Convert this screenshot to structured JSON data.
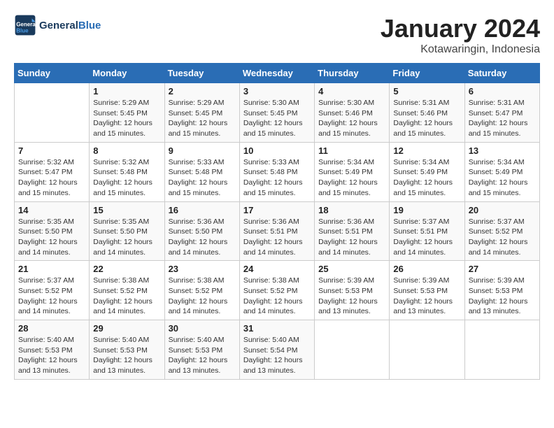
{
  "header": {
    "logo_text_general": "General",
    "logo_text_blue": "Blue",
    "title": "January 2024",
    "subtitle": "Kotawaringin, Indonesia"
  },
  "columns": [
    "Sunday",
    "Monday",
    "Tuesday",
    "Wednesday",
    "Thursday",
    "Friday",
    "Saturday"
  ],
  "weeks": [
    [
      {
        "day": "",
        "info": ""
      },
      {
        "day": "1",
        "info": "Sunrise: 5:29 AM\nSunset: 5:45 PM\nDaylight: 12 hours\nand 15 minutes."
      },
      {
        "day": "2",
        "info": "Sunrise: 5:29 AM\nSunset: 5:45 PM\nDaylight: 12 hours\nand 15 minutes."
      },
      {
        "day": "3",
        "info": "Sunrise: 5:30 AM\nSunset: 5:45 PM\nDaylight: 12 hours\nand 15 minutes."
      },
      {
        "day": "4",
        "info": "Sunrise: 5:30 AM\nSunset: 5:46 PM\nDaylight: 12 hours\nand 15 minutes."
      },
      {
        "day": "5",
        "info": "Sunrise: 5:31 AM\nSunset: 5:46 PM\nDaylight: 12 hours\nand 15 minutes."
      },
      {
        "day": "6",
        "info": "Sunrise: 5:31 AM\nSunset: 5:47 PM\nDaylight: 12 hours\nand 15 minutes."
      }
    ],
    [
      {
        "day": "7",
        "info": "Sunrise: 5:32 AM\nSunset: 5:47 PM\nDaylight: 12 hours\nand 15 minutes."
      },
      {
        "day": "8",
        "info": "Sunrise: 5:32 AM\nSunset: 5:48 PM\nDaylight: 12 hours\nand 15 minutes."
      },
      {
        "day": "9",
        "info": "Sunrise: 5:33 AM\nSunset: 5:48 PM\nDaylight: 12 hours\nand 15 minutes."
      },
      {
        "day": "10",
        "info": "Sunrise: 5:33 AM\nSunset: 5:48 PM\nDaylight: 12 hours\nand 15 minutes."
      },
      {
        "day": "11",
        "info": "Sunrise: 5:34 AM\nSunset: 5:49 PM\nDaylight: 12 hours\nand 15 minutes."
      },
      {
        "day": "12",
        "info": "Sunrise: 5:34 AM\nSunset: 5:49 PM\nDaylight: 12 hours\nand 15 minutes."
      },
      {
        "day": "13",
        "info": "Sunrise: 5:34 AM\nSunset: 5:49 PM\nDaylight: 12 hours\nand 15 minutes."
      }
    ],
    [
      {
        "day": "14",
        "info": "Sunrise: 5:35 AM\nSunset: 5:50 PM\nDaylight: 12 hours\nand 14 minutes."
      },
      {
        "day": "15",
        "info": "Sunrise: 5:35 AM\nSunset: 5:50 PM\nDaylight: 12 hours\nand 14 minutes."
      },
      {
        "day": "16",
        "info": "Sunrise: 5:36 AM\nSunset: 5:50 PM\nDaylight: 12 hours\nand 14 minutes."
      },
      {
        "day": "17",
        "info": "Sunrise: 5:36 AM\nSunset: 5:51 PM\nDaylight: 12 hours\nand 14 minutes."
      },
      {
        "day": "18",
        "info": "Sunrise: 5:36 AM\nSunset: 5:51 PM\nDaylight: 12 hours\nand 14 minutes."
      },
      {
        "day": "19",
        "info": "Sunrise: 5:37 AM\nSunset: 5:51 PM\nDaylight: 12 hours\nand 14 minutes."
      },
      {
        "day": "20",
        "info": "Sunrise: 5:37 AM\nSunset: 5:52 PM\nDaylight: 12 hours\nand 14 minutes."
      }
    ],
    [
      {
        "day": "21",
        "info": "Sunrise: 5:37 AM\nSunset: 5:52 PM\nDaylight: 12 hours\nand 14 minutes."
      },
      {
        "day": "22",
        "info": "Sunrise: 5:38 AM\nSunset: 5:52 PM\nDaylight: 12 hours\nand 14 minutes."
      },
      {
        "day": "23",
        "info": "Sunrise: 5:38 AM\nSunset: 5:52 PM\nDaylight: 12 hours\nand 14 minutes."
      },
      {
        "day": "24",
        "info": "Sunrise: 5:38 AM\nSunset: 5:52 PM\nDaylight: 12 hours\nand 14 minutes."
      },
      {
        "day": "25",
        "info": "Sunrise: 5:39 AM\nSunset: 5:53 PM\nDaylight: 12 hours\nand 13 minutes."
      },
      {
        "day": "26",
        "info": "Sunrise: 5:39 AM\nSunset: 5:53 PM\nDaylight: 12 hours\nand 13 minutes."
      },
      {
        "day": "27",
        "info": "Sunrise: 5:39 AM\nSunset: 5:53 PM\nDaylight: 12 hours\nand 13 minutes."
      }
    ],
    [
      {
        "day": "28",
        "info": "Sunrise: 5:40 AM\nSunset: 5:53 PM\nDaylight: 12 hours\nand 13 minutes."
      },
      {
        "day": "29",
        "info": "Sunrise: 5:40 AM\nSunset: 5:53 PM\nDaylight: 12 hours\nand 13 minutes."
      },
      {
        "day": "30",
        "info": "Sunrise: 5:40 AM\nSunset: 5:53 PM\nDaylight: 12 hours\nand 13 minutes."
      },
      {
        "day": "31",
        "info": "Sunrise: 5:40 AM\nSunset: 5:54 PM\nDaylight: 12 hours\nand 13 minutes."
      },
      {
        "day": "",
        "info": ""
      },
      {
        "day": "",
        "info": ""
      },
      {
        "day": "",
        "info": ""
      }
    ]
  ]
}
